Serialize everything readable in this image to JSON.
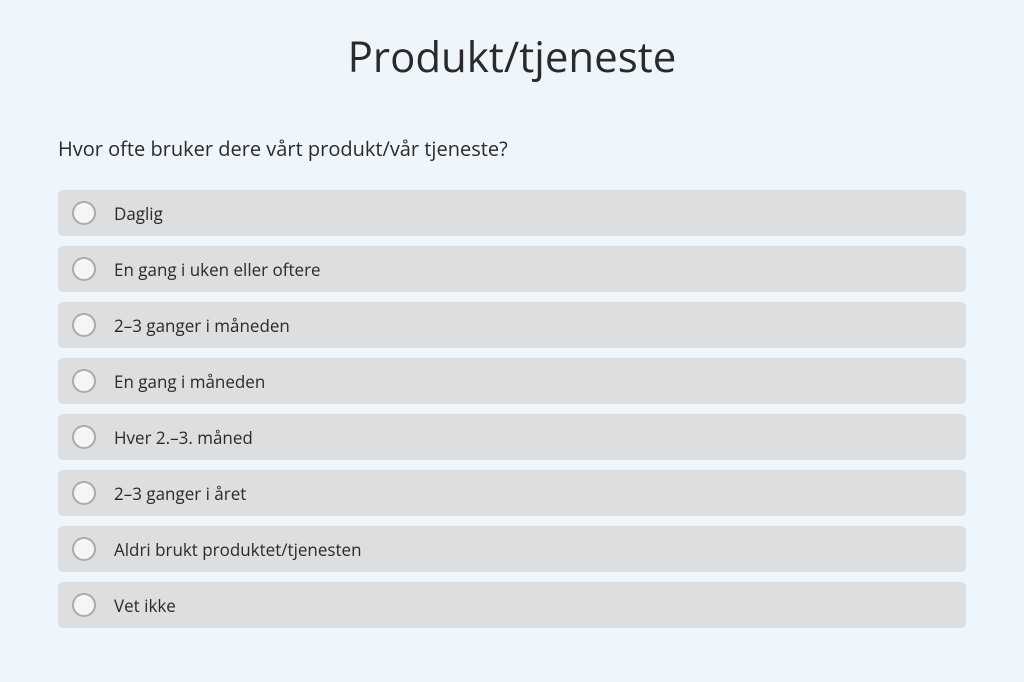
{
  "title": "Produkt/tjeneste",
  "question": "Hvor ofte bruker dere vårt produkt/vår tjeneste?",
  "options": [
    {
      "label": "Daglig"
    },
    {
      "label": "En gang i uken eller oftere"
    },
    {
      "label": "2–3 ganger i måneden"
    },
    {
      "label": "En gang i måneden"
    },
    {
      "label": "Hver 2.–3. måned"
    },
    {
      "label": "2–3 ganger i året"
    },
    {
      "label": "Aldri brukt produktet/tjenesten"
    },
    {
      "label": "Vet ikke"
    }
  ]
}
